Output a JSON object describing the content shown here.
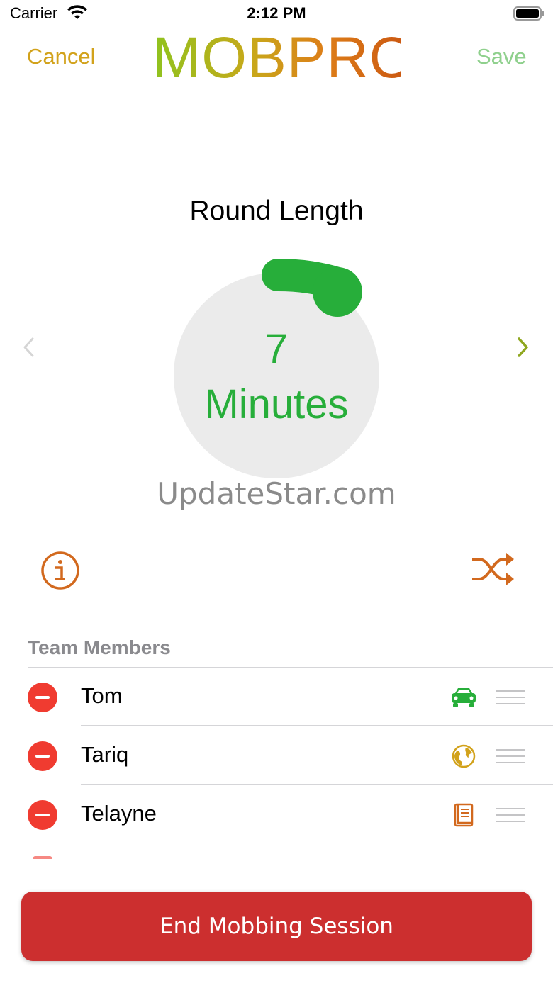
{
  "status_bar": {
    "carrier": "Carrier",
    "time": "2:12 PM"
  },
  "nav": {
    "cancel_label": "Cancel",
    "title": "MOBPRO",
    "save_label": "Save"
  },
  "round": {
    "title": "Round Length",
    "value": "7",
    "unit": "Minutes"
  },
  "watermark": "UpdateStar.com",
  "team": {
    "header": "Team Members",
    "members": [
      {
        "name": "Tom",
        "icon": "car-icon",
        "icon_color": "#27ae3a"
      },
      {
        "name": "Tariq",
        "icon": "globe-icon",
        "icon_color": "#d2a21b"
      },
      {
        "name": "Telayne",
        "icon": "book-icon",
        "icon_color": "#d2691e"
      }
    ]
  },
  "actions": {
    "end_session_label": "End Mobbing Session"
  },
  "colors": {
    "accent_green": "#27ae3a",
    "accent_gold": "#d2a21b",
    "accent_orange": "#d2691e",
    "destructive": "#cc2f2f"
  }
}
